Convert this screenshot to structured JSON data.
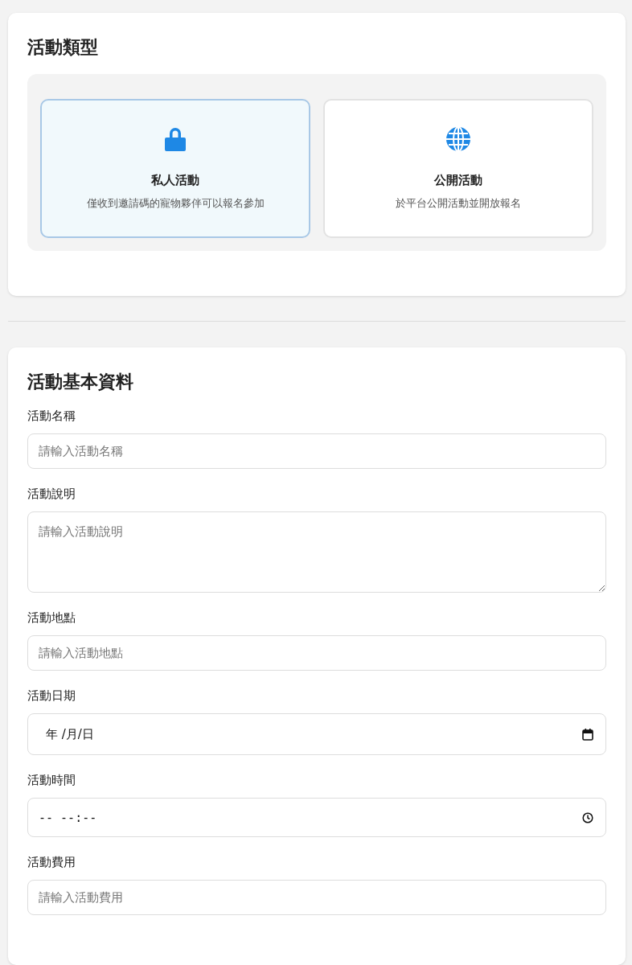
{
  "activity_type": {
    "title": "活動類型",
    "options": [
      {
        "kind": "lock",
        "label": "私人活動",
        "description": "僅收到邀請碼的寵物夥伴可以報名參加",
        "selected": true
      },
      {
        "kind": "globe",
        "label": "公開活動",
        "description": "於平台公開活動並開放報名",
        "selected": false
      }
    ]
  },
  "basic_info": {
    "title": "活動基本資料",
    "fields": [
      {
        "kind": "text",
        "label": "活動名稱",
        "placeholder": "請輸入活動名稱"
      },
      {
        "kind": "textarea",
        "label": "活動說明",
        "placeholder": "請輸入活動說明"
      },
      {
        "kind": "text",
        "label": "活動地點",
        "placeholder": "請輸入活動地點"
      },
      {
        "kind": "date",
        "label": "活動日期",
        "placeholder": "年 /月/日"
      },
      {
        "kind": "time",
        "label": "活動時間",
        "placeholder": "-- --:--"
      },
      {
        "kind": "text",
        "label": "活動費用",
        "placeholder": "請輸入活動費用"
      }
    ]
  }
}
